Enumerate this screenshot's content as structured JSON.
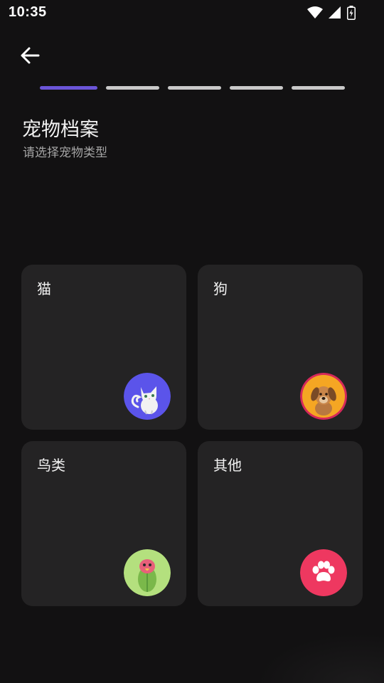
{
  "status_bar": {
    "time": "10:35"
  },
  "header": {
    "back_icon": "arrow-left-icon"
  },
  "progress": {
    "total_steps": 5,
    "current_step": 1
  },
  "page": {
    "title": "宠物档案",
    "subtitle": "请选择宠物类型"
  },
  "pet_types": [
    {
      "label": "猫",
      "icon": "cat-icon",
      "color": "#5b54ea"
    },
    {
      "label": "狗",
      "icon": "dog-icon",
      "color": "#f5a623"
    },
    {
      "label": "鸟类",
      "icon": "bird-icon",
      "color": "#b4e07e"
    },
    {
      "label": "其他",
      "icon": "paw-icon",
      "color": "#ee3860"
    }
  ],
  "colors": {
    "background": "#121112",
    "card": "#242324",
    "accent": "#6b55d8"
  }
}
